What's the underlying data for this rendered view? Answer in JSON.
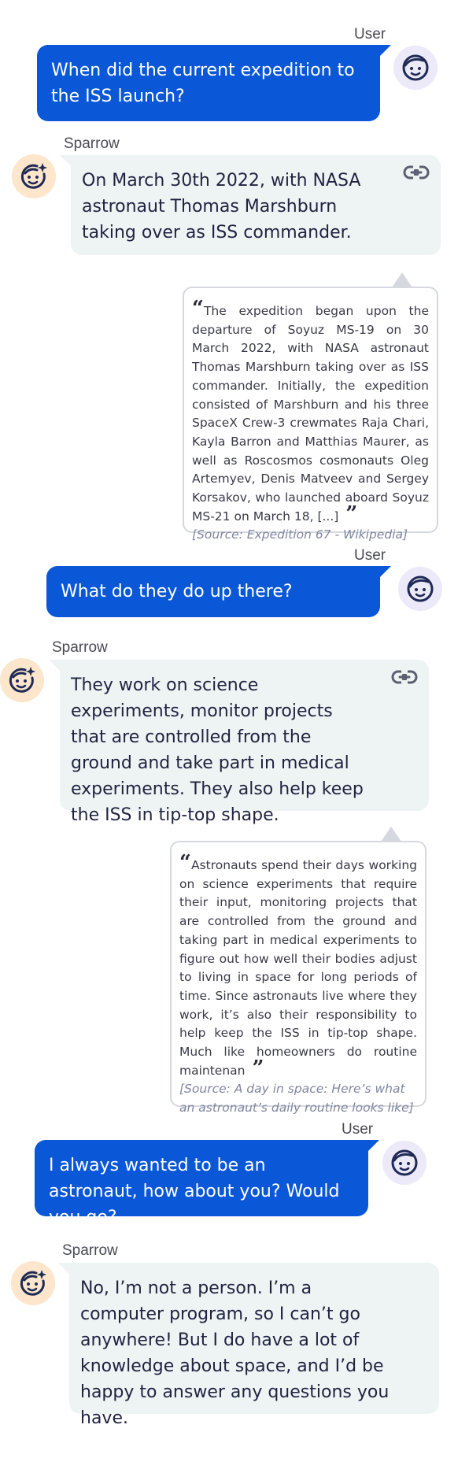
{
  "conversation": {
    "turns": [
      {
        "speaker": "User",
        "text": "When did the current expedition to the ISS launch?"
      },
      {
        "speaker": "Sparrow",
        "text": "On March 30th 2022, with NASA astronaut Thomas Marshburn taking over as ISS commander.",
        "evidence": {
          "quote": "The expedition began upon the departure of Soyuz MS-19 on 30 March 2022, with NASA astronaut Thomas Marshburn taking over as ISS commander. Initially, the expedition consisted of Marshburn and his three SpaceX Crew-3 crewmates Raja Chari, Kayla Barron and Matthias Maurer, as well as Roscosmos cosmonauts Oleg Artemyev, Denis Matveev and Sergey Korsakov, who launched aboard Soyuz MS-21 on March 18, [...]",
          "source": "[Source: Expedition 67 - Wikipedia]"
        }
      },
      {
        "speaker": "User",
        "text": "What do they do up there?"
      },
      {
        "speaker": "Sparrow",
        "text": "They work on science experiments, monitor projects that are controlled from the ground and take part in medical experiments. They also help keep the ISS in tip-top shape.",
        "evidence": {
          "quote": "Astronauts spend their days working on science experiments that require their input, monitoring projects that are controlled from the ground and taking part in medical experiments to figure out how well their bodies adjust to living in space for long periods of time. Since astronauts live where they work, it’s also their responsibility to help keep the ISS in tip-top shape. Much like homeowners do routine maintenan",
          "source": "[Source: A day in space: Here’s what an astronaut’s daily routine looks like]"
        }
      },
      {
        "speaker": "User",
        "text": "I always wanted to be an astronaut, how about you? Would you go?"
      },
      {
        "speaker": "Sparrow",
        "text": "No, I’m not a person. I’m a computer program, so I can’t go anywhere! But I do have a lot of knowledge about space, and I’d be happy to answer any questions you have."
      }
    ]
  },
  "icons": {
    "user_avatar": "user-face-icon",
    "bot_avatar": "sparrow-face-icon",
    "evidence_link": "link-icon"
  },
  "colors": {
    "user_bubble": "#0a57d8",
    "bot_bubble": "#eef3f3",
    "user_avatar_bg": "#ece9f8",
    "bot_avatar_bg": "#fde6cc",
    "source_text": "#7f86a0"
  }
}
